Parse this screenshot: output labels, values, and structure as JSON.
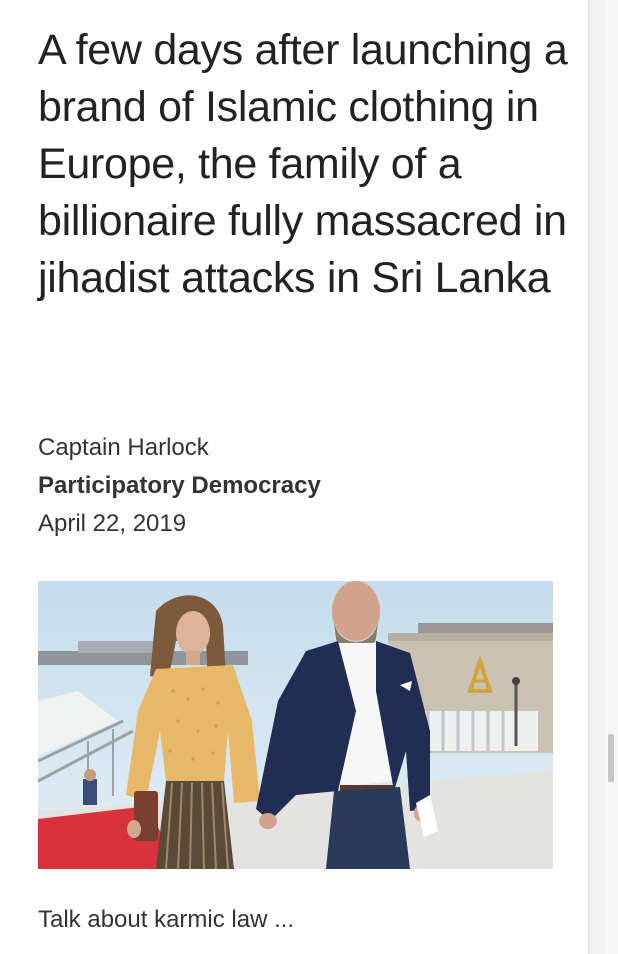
{
  "article": {
    "headline": "A few days after launching a brand of Islamic clothing in Europe, the family of a billionaire fully massacred in jihadist attacks in Sri Lanka",
    "author": "Captain Harlock",
    "source": "Participatory Democracy",
    "date": "April 22, 2019",
    "caption": "Talk about karmic law ..."
  },
  "colors": {
    "text": "#222222",
    "background": "#ffffff"
  }
}
